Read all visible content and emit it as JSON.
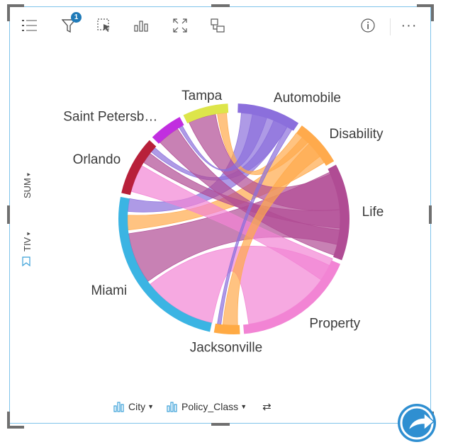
{
  "toolbar": {
    "legend_icon": "list-icon",
    "filter_icon": "filter-icon",
    "filter_badge": "1",
    "select_icon": "select-icon",
    "visualization_icon": "bar-chart-icon",
    "maximize_icon": "maximize-icon",
    "flip_icon": "flip-card-icon",
    "info_icon": "info-icon",
    "more_label": "···"
  },
  "y_axis": {
    "stat_label": "SUM",
    "field_label": "TIV"
  },
  "x_axis": {
    "field1": "City",
    "field2": "Policy_Class"
  },
  "chart_data": {
    "type": "chord",
    "labels": [
      "Automobile",
      "Disability",
      "Life",
      "Property",
      "Jacksonville",
      "Miami",
      "Orlando",
      "Saint Petersb…",
      "Tampa"
    ],
    "colors": {
      "Automobile": "#8b6fdc",
      "Disability": "#ffaa4c",
      "Life": "#b04c94",
      "Property": "#f284d4",
      "Jacksonville": "#ffaa44",
      "Miami": "#3bb4e3",
      "Orlando": "#b8203a",
      "Saint Petersb…": "#c12ee0",
      "Tampa": "#dde54a"
    },
    "arcs": [
      {
        "name": "Automobile",
        "start": 2,
        "end": 34
      },
      {
        "name": "Disability",
        "start": 36,
        "end": 60
      },
      {
        "name": "Life",
        "start": 62,
        "end": 111
      },
      {
        "name": "Property",
        "start": 113,
        "end": 175
      },
      {
        "name": "Jacksonville",
        "start": 177,
        "end": 190
      },
      {
        "name": "Miami",
        "start": 192,
        "end": 281
      },
      {
        "name": "Orlando",
        "start": 283,
        "end": 313
      },
      {
        "name": "Saint Petersb…",
        "start": 315,
        "end": 332
      },
      {
        "name": "Tampa",
        "start": 334,
        "end": 357
      }
    ],
    "chords": [
      {
        "a": [
          192,
          232
        ],
        "b": [
          116,
          172
        ],
        "color": "#f284d4"
      },
      {
        "a": [
          234,
          262
        ],
        "b": [
          64,
          104
        ],
        "color": "#b04c94"
      },
      {
        "a": [
          264,
          272
        ],
        "b": [
          40,
          58
        ],
        "color": "#ffaa4c"
      },
      {
        "a": [
          274,
          281
        ],
        "b": [
          4,
          30
        ],
        "color": "#8b6fdc"
      },
      {
        "a": [
          285,
          300
        ],
        "b": [
          112,
          125
        ],
        "color": "#f284d4"
      },
      {
        "a": [
          302,
          308
        ],
        "b": [
          85,
          95
        ],
        "color": "#b04c94"
      },
      {
        "a": [
          309,
          312
        ],
        "b": [
          22,
          30
        ],
        "color": "#8b6fdc"
      },
      {
        "a": [
          335,
          350
        ],
        "b": [
          65,
          85
        ],
        "color": "#b04c94"
      },
      {
        "a": [
          351,
          356
        ],
        "b": [
          36,
          44
        ],
        "color": "#ffaa4c"
      },
      {
        "a": [
          316,
          328
        ],
        "b": [
          96,
          110
        ],
        "color": "#b04c94"
      },
      {
        "a": [
          329,
          331
        ],
        "b": [
          10,
          18
        ],
        "color": "#8b6fdc"
      },
      {
        "a": [
          178,
          186
        ],
        "b": [
          45,
          54
        ],
        "color": "#ffaa4c"
      },
      {
        "a": [
          187,
          189
        ],
        "b": [
          30,
          33
        ],
        "color": "#8b6fdc"
      }
    ]
  }
}
